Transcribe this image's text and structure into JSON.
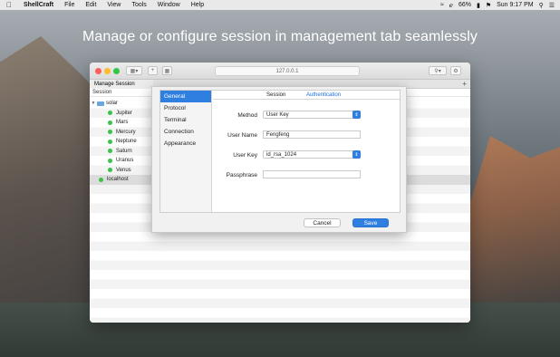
{
  "menubar": {
    "app_name": "ShellCraft",
    "items": [
      "File",
      "Edit",
      "View",
      "Tools",
      "Window",
      "Help"
    ],
    "battery": "66%",
    "clock": "Sun 9:17 PM"
  },
  "headline": "Manage or configure session in management tab seamlessly",
  "window": {
    "address": "127.0.0.1",
    "tab_label": "Manage Session",
    "tab_add": "+",
    "list_header": "Session",
    "tree": {
      "group": "solar",
      "hosts": [
        "Jupiter",
        "Mars",
        "Mercury",
        "Neptune",
        "Saturn",
        "Uranus",
        "Venus"
      ],
      "extra": "localhost"
    }
  },
  "dialog": {
    "sidebar": [
      "General",
      "Protocol",
      "Terminal",
      "Connection",
      "Appearance"
    ],
    "tabs": [
      "Session",
      "Authentication"
    ],
    "fields": {
      "method_label": "Method",
      "method_value": "User Key",
      "username_label": "User Name",
      "username_value": "Fengfeng",
      "userkey_label": "User Key",
      "userkey_value": "id_rsa_1024",
      "passphrase_label": "Passphrase",
      "passphrase_value": ""
    },
    "cancel": "Cancel",
    "save": "Save"
  }
}
